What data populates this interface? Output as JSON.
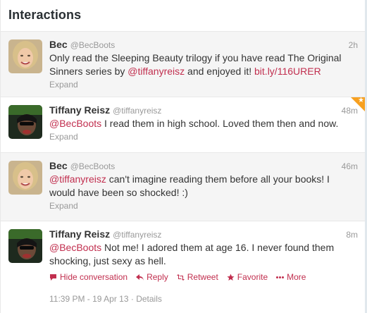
{
  "header": {
    "title": "Interactions"
  },
  "tweets": [
    {
      "name": "Bec",
      "handle": "@BecBoots",
      "time": "2h",
      "text_plain_1": "Only read the Sleeping Beauty trilogy if you have read The Original Sinners series by ",
      "mention": "@tiffanyreisz",
      "text_plain_2": " and enjoyed it! ",
      "link": "bit.ly/116URER",
      "expand": "Expand"
    },
    {
      "name": "Tiffany Reisz",
      "handle": "@tiffanyreisz",
      "time": "48m",
      "mention": "@BecBoots",
      "text_plain_1": " I read them in high school. Loved them then and now.",
      "expand": "Expand"
    },
    {
      "name": "Bec",
      "handle": "@BecBoots",
      "time": "46m",
      "mention": "@tiffanyreisz",
      "text_plain_1": " can't imagine reading them before all your books! I would have been so shocked! :)",
      "expand": "Expand"
    },
    {
      "name": "Tiffany Reisz",
      "handle": "@tiffanyreisz",
      "time": "8m",
      "mention": "@BecBoots",
      "text_plain_1": " Not me! I adored them at age 16. I never found them shocking, just sexy as hell.",
      "actions": {
        "hide": "Hide conversation",
        "reply": "Reply",
        "retweet": "Retweet",
        "favorite": "Favorite",
        "more": "More"
      },
      "timestamp": "11:39 PM - 19 Apr 13",
      "separator": "·",
      "details": "Details"
    }
  ],
  "colors": {
    "link": "#c12e4e",
    "favorite_corner": "#f7a01f"
  }
}
